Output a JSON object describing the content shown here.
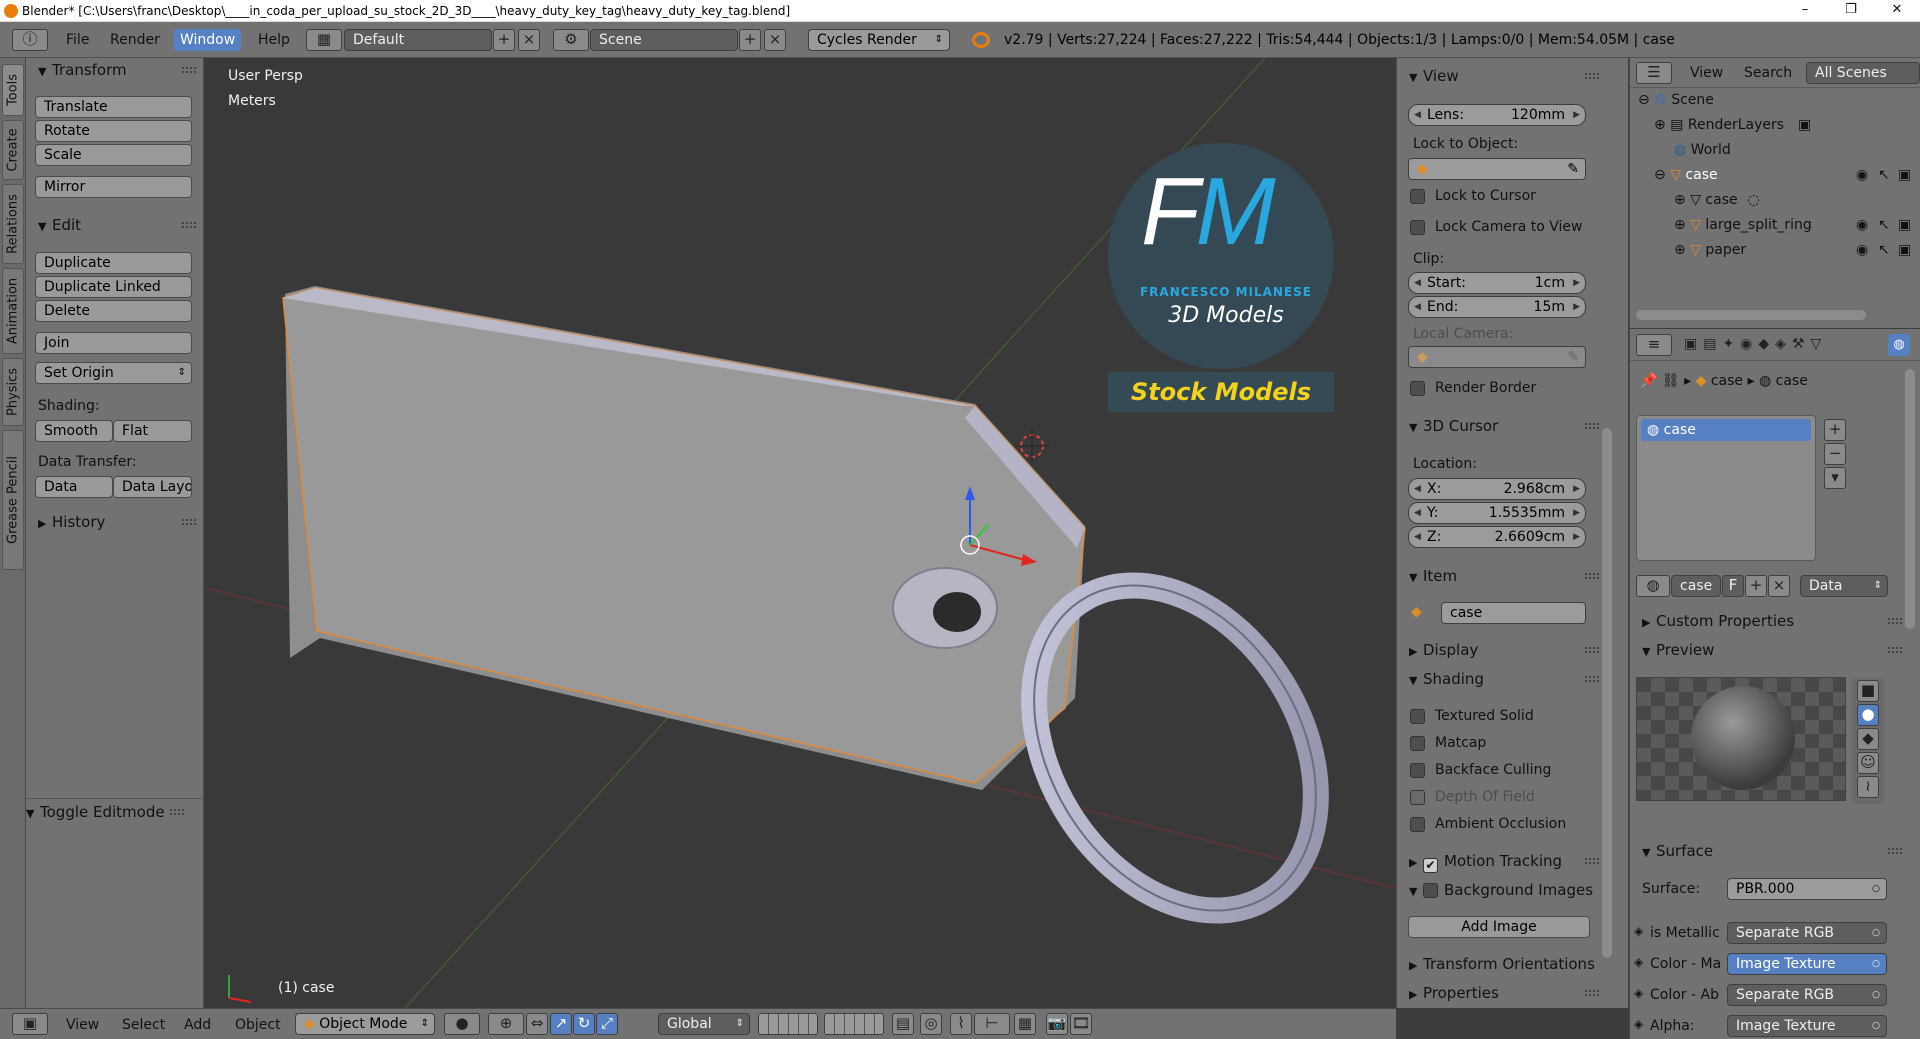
{
  "window": {
    "title": "Blender* [C:\\Users\\franc\\Desktop\\____in_coda_per_upload_su_stock_2D_3D____\\heavy_duty_key_tag\\heavy_duty_key_tag.blend]",
    "minimize": "–",
    "maximize": "❐",
    "close": "✕"
  },
  "info_header": {
    "editor_type_icon": "info-icon",
    "menus": [
      "File",
      "Render",
      "Window",
      "Help"
    ],
    "active_menu": "Window",
    "screen_layout": "Default",
    "scene": "Scene",
    "render_engine": "Cycles Render",
    "stats": "v2.79 | Verts:27,224 | Faces:27,222 | Tris:54,444 | Objects:1/3 | Lamps:0/0 | Mem:54.05M | case"
  },
  "tool_tabs": [
    "Tools",
    "Create",
    "Relations",
    "Animation",
    "Physics",
    "Grease Pencil"
  ],
  "toolshelf": {
    "transform": {
      "header": "Transform",
      "buttons": [
        "Translate",
        "Rotate",
        "Scale",
        "Mirror"
      ]
    },
    "edit": {
      "header": "Edit",
      "buttons": [
        "Duplicate",
        "Duplicate Linked",
        "Delete",
        "Join"
      ],
      "set_origin": "Set Origin",
      "shading_label": "Shading:",
      "shading_smooth": "Smooth",
      "shading_flat": "Flat",
      "data_transfer_label": "Data Transfer:",
      "data_btn": "Data",
      "data_layout_btn": "Data Layo"
    },
    "history": {
      "header": "History"
    },
    "operator": {
      "header": "Toggle Editmode"
    }
  },
  "viewport": {
    "view_label": "User Persp",
    "units_label": "Meters",
    "object_label": "(1) case",
    "watermark": {
      "monogram": "FM",
      "author": "FRANCESCO MILANESE",
      "subtitle": "3D Models",
      "banner": "Stock Models"
    }
  },
  "properties_panel": {
    "view": {
      "header": "View",
      "lens_label": "Lens:",
      "lens_value": "120mm",
      "lock_to_object": "Lock to Object:",
      "lock_to_cursor": "Lock to Cursor",
      "lock_camera": "Lock Camera to View",
      "clip_label": "Clip:",
      "clip_start_label": "Start:",
      "clip_start": "1cm",
      "clip_end_label": "End:",
      "clip_end": "15m",
      "local_camera": "Local Camera:",
      "render_border": "Render Border"
    },
    "cursor": {
      "header": "3D Cursor",
      "location_label": "Location:",
      "x_label": "X:",
      "x": "2.968cm",
      "y_label": "Y:",
      "y": "1.5535mm",
      "z_label": "Z:",
      "z": "2.6609cm"
    },
    "item": {
      "header": "Item",
      "name": "case"
    },
    "display": {
      "header": "Display"
    },
    "shading": {
      "header": "Shading",
      "textured_solid": "Textured Solid",
      "matcap": "Matcap",
      "backface_culling": "Backface Culling",
      "depth_of_field": "Depth Of Field",
      "ambient_occlusion": "Ambient Occlusion"
    },
    "motion_tracking": {
      "header": "Motion Tracking",
      "checked": true
    },
    "background_images": {
      "header": "Background Images",
      "add_button": "Add Image"
    },
    "transform_orientations": {
      "header": "Transform Orientations"
    },
    "properties": {
      "header": "Properties"
    }
  },
  "outliner": {
    "tabs": [
      "View",
      "Search",
      "All Scenes"
    ],
    "rows": [
      {
        "label": "Scene",
        "icon": "scene-icon"
      },
      {
        "label": "RenderLayers",
        "icon": "renderlayers-icon"
      },
      {
        "label": "World",
        "icon": "world-icon"
      },
      {
        "label": "case",
        "icon": "object-icon"
      },
      {
        "label": "case",
        "icon": "mesh-icon"
      },
      {
        "label": "large_split_ring",
        "icon": "object-icon"
      },
      {
        "label": "paper",
        "icon": "object-icon"
      }
    ]
  },
  "material_editor": {
    "breadcrumb": [
      "case",
      "case"
    ],
    "slot": "case",
    "material_name": "case",
    "fake_user": "F",
    "link_type": "Data",
    "custom_properties": "Custom Properties",
    "preview": "Preview",
    "surface_header": "Surface",
    "surface_label": "Surface:",
    "surface_value": "PBR.000",
    "inputs": [
      {
        "label": "is Metallic",
        "value": "Separate RGB"
      },
      {
        "label": "Color - Ma",
        "value": "Image Texture"
      },
      {
        "label": "Color - Ab",
        "value": "Separate RGB"
      },
      {
        "label": "Alpha:",
        "value": "Image Texture"
      }
    ]
  },
  "bottom_bar": {
    "menus": [
      "View",
      "Select",
      "Add",
      "Object"
    ],
    "mode": "Object Mode",
    "orientation": "Global"
  },
  "colors": {
    "accent": "#5680c2",
    "selected_outline": "#f2a03c",
    "brand_blue": "#29a8e0",
    "brand_yellow": "#f2d21c"
  }
}
